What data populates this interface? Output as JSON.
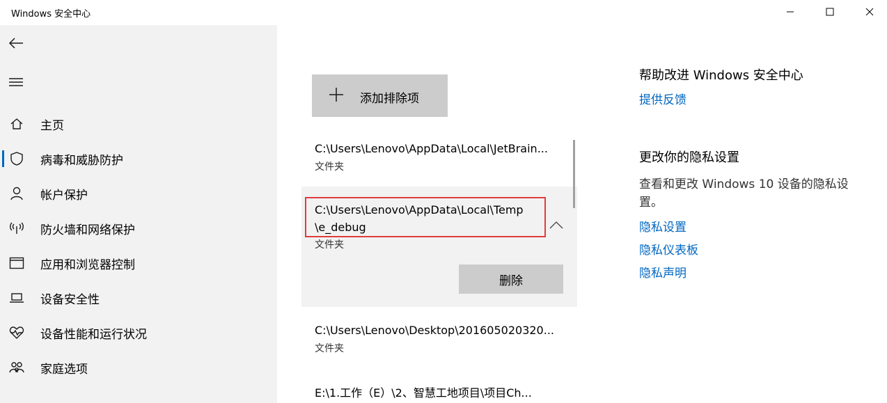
{
  "window": {
    "title": "Windows 安全中心",
    "minimize_icon": "minimize-icon",
    "maximize_icon": "maximize-icon",
    "close_icon": "close-icon"
  },
  "sidebar": {
    "back_icon": "back-arrow-icon",
    "menu_icon": "hamburger-menu-icon",
    "items": [
      {
        "label": "主页",
        "icon": "home-icon",
        "active": false
      },
      {
        "label": "病毒和威胁防护",
        "icon": "shield-icon",
        "active": true
      },
      {
        "label": "帐户保护",
        "icon": "person-icon",
        "active": false
      },
      {
        "label": "防火墙和网络保护",
        "icon": "wifi-antenna-icon",
        "active": false
      },
      {
        "label": "应用和浏览器控制",
        "icon": "browser-window-icon",
        "active": false
      },
      {
        "label": "设备安全性",
        "icon": "laptop-icon",
        "active": false
      },
      {
        "label": "设备性能和运行状况",
        "icon": "heart-pulse-icon",
        "active": false
      },
      {
        "label": "家庭选项",
        "icon": "family-icon",
        "active": false
      }
    ]
  },
  "main": {
    "add_button_label": "添加排除项",
    "exclusions": [
      {
        "path": "C:\\Users\\Lenovo\\AppData\\Local\\JetBrain...",
        "type": "文件夹"
      },
      {
        "path_line1": "C:\\Users\\Lenovo\\AppData\\Local\\Temp",
        "path_line2": "\\e_debug",
        "type": "文件夹",
        "expanded": true,
        "delete_label": "删除"
      },
      {
        "path": "C:\\Users\\Lenovo\\Desktop\\201605020320...",
        "type": "文件夹"
      },
      {
        "path": "E:\\1.工作（E）\\2、智慧工地项目\\项目Ch..."
      }
    ]
  },
  "right": {
    "help_heading": "帮助改进 Windows 安全中心",
    "feedback_link": "提供反馈",
    "privacy_heading": "更改你的隐私设置",
    "privacy_desc": "查看和更改 Windows 10 设备的隐私设置。",
    "links": [
      "隐私设置",
      "隐私仪表板",
      "隐私声明"
    ]
  },
  "colors": {
    "accent": "#0067c0",
    "sidebar_bg": "#f2f2f2",
    "button_bg": "#cccccc",
    "highlight_border": "#e03c3c"
  }
}
